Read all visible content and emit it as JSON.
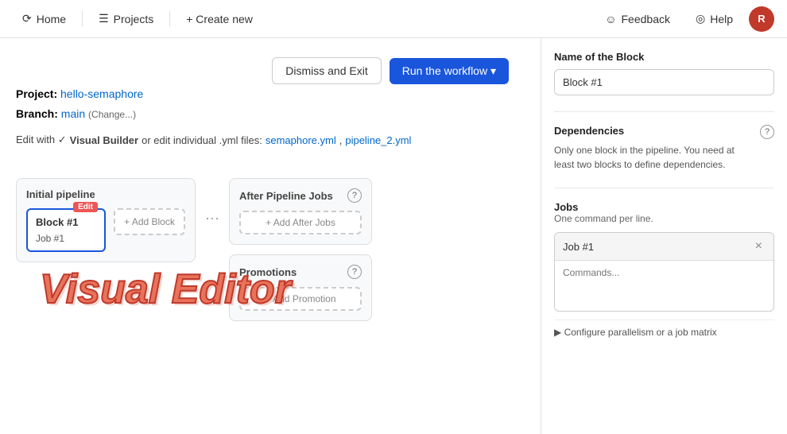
{
  "nav": {
    "home_label": "Home",
    "projects_label": "Projects",
    "create_label": "+ Create new",
    "feedback_label": "Feedback",
    "help_label": "Help",
    "avatar_initials": "R"
  },
  "project": {
    "label": "Project:",
    "name": "hello-semaphore",
    "branch_label": "Branch:",
    "branch": "main",
    "change_label": "(Change...)"
  },
  "edit_bar": {
    "text1": "Edit with ✓",
    "visual_builder": "Visual Builder",
    "text2": "or edit individual .yml files:",
    "file1": "semaphore.yml",
    "file2": "pipeline_2.yml"
  },
  "actions": {
    "dismiss_label": "Dismiss and Exit",
    "run_label": "Run the workflow ▾"
  },
  "pipeline": {
    "initial_title": "Initial pipeline",
    "block_name": "Block #1",
    "job_name": "Job #1",
    "edit_badge": "Edit",
    "add_block_label": "+ Add Block",
    "after_jobs_title": "After Pipeline Jobs",
    "after_help": "?",
    "add_after_label": "+ Add After Jobs",
    "promotions_title": "Promotions",
    "promotions_help": "?",
    "add_promo_label": "+ Add Promotion"
  },
  "visual_editor_text": "Visual Editor",
  "right_panel": {
    "block_name_label": "Name of the Block",
    "block_name_value": "Block #1",
    "dependencies_label": "Dependencies",
    "dependencies_help": "?",
    "dependencies_text": "Only one block in the pipeline. You need at least two blocks to define dependencies.",
    "jobs_label": "Jobs",
    "jobs_sublabel": "One command per line.",
    "job_name": "Job #1",
    "commands_placeholder": "Commands...",
    "configure_label": "▶ Configure parallelism or a job matrix"
  }
}
